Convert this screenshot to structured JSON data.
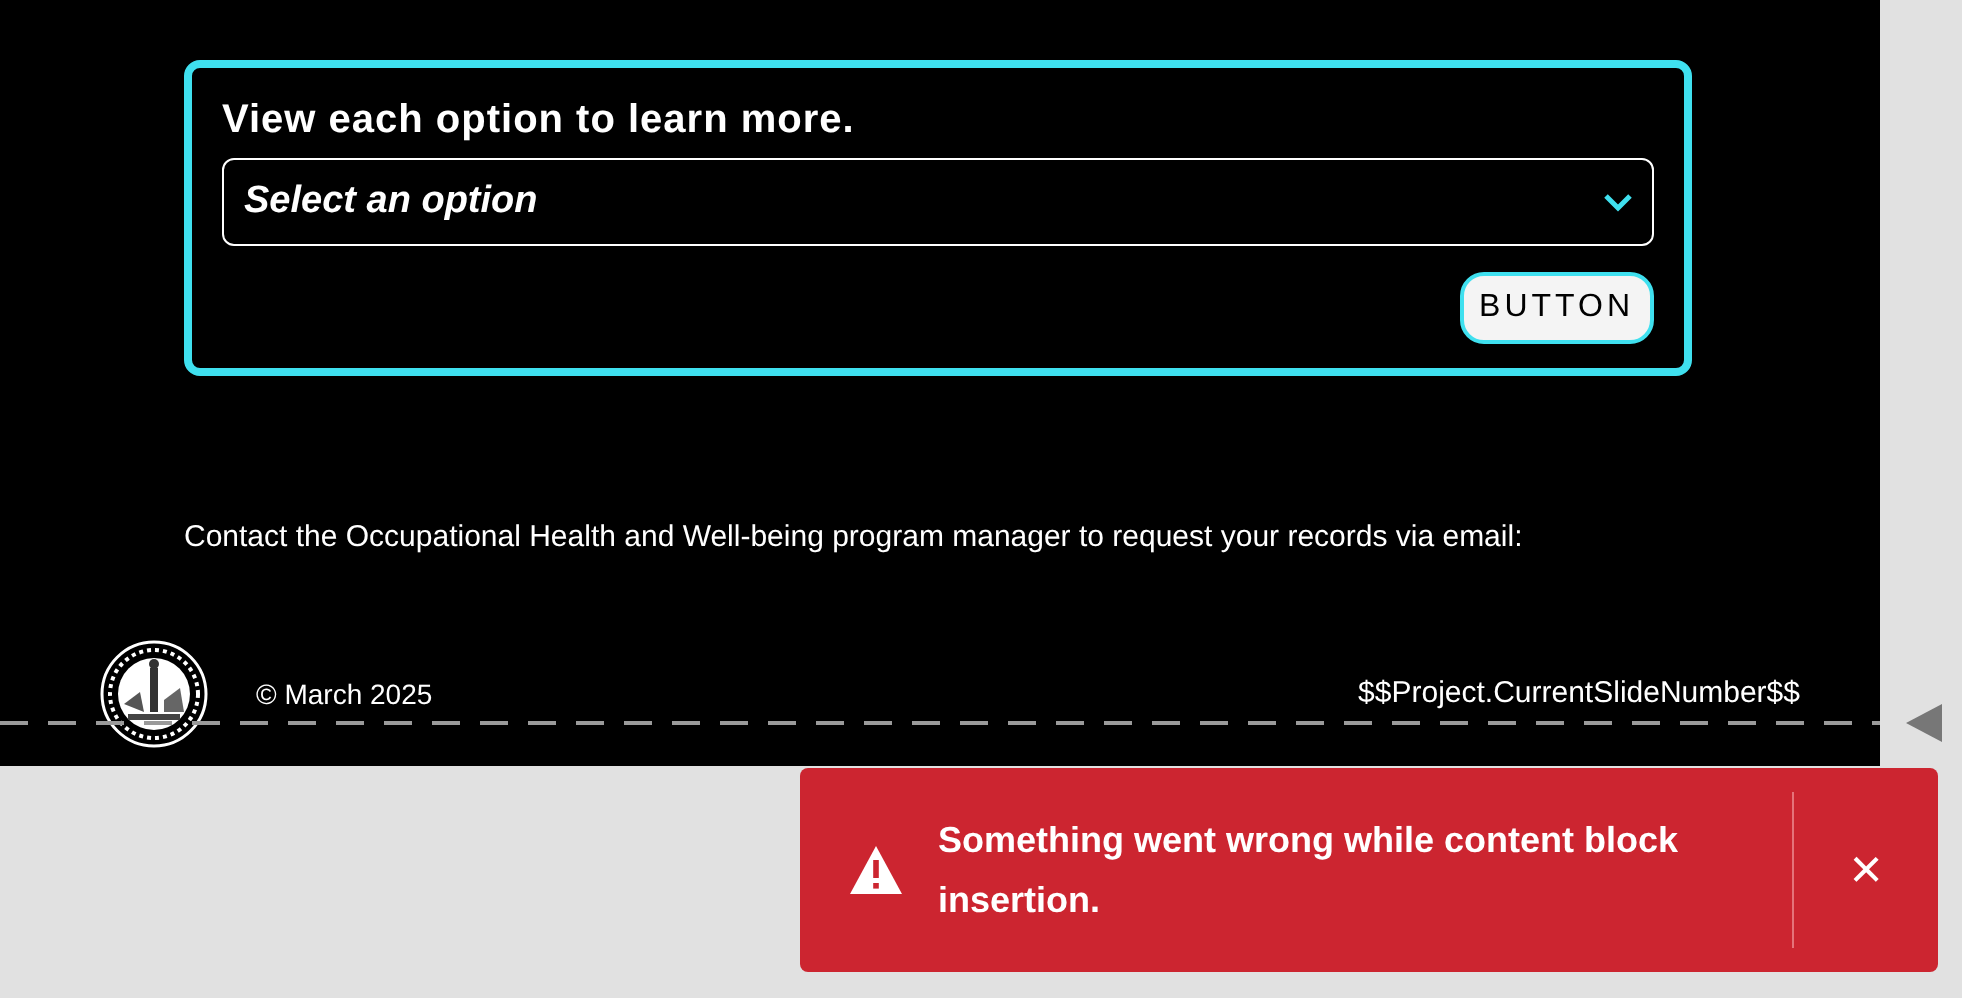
{
  "card": {
    "heading": "View each option to learn more.",
    "select": {
      "placeholder": "Select an option"
    },
    "button": "BUTTON"
  },
  "contact_text": "Contact the Occupational Health and Well-being program manager to request your records via email:",
  "footer": {
    "copyright": "© March 2025",
    "slide_number": "$$Project.CurrentSlideNumber$$"
  },
  "toast": {
    "kind": "error",
    "message": "Something went wrong while content block insertion.",
    "close": "×"
  }
}
